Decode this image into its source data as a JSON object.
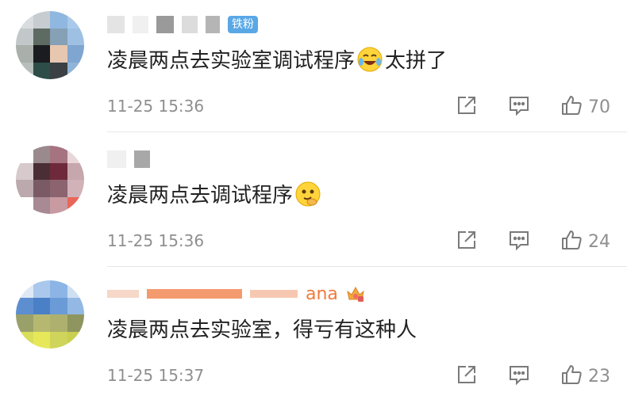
{
  "comments": [
    {
      "badge": "铁粉",
      "text": "凌晨两点去实验室调试程序",
      "text_after": "太拼了",
      "emoji": "laughing-tears-emoji",
      "time": "11-25 15:36",
      "likes": "70"
    },
    {
      "text": "凌晨两点去调试程序",
      "emoji": "thinking-emoji",
      "time": "11-25 15:36",
      "likes": "24"
    },
    {
      "name_partial": "ana",
      "name_badge_icon": "crown-vip-icon",
      "text": "凌晨两点去实验室，得亏有这种人",
      "time": "11-25 15:37",
      "likes": "23"
    }
  ],
  "icons": {
    "share": "share-icon",
    "reply": "reply-icon",
    "like": "thumbs-up-icon"
  },
  "colors": {
    "badge": "#5aa7e6",
    "name_orange": "#f07a3c",
    "meta_gray": "#8f8f8f",
    "text": "#222222"
  }
}
